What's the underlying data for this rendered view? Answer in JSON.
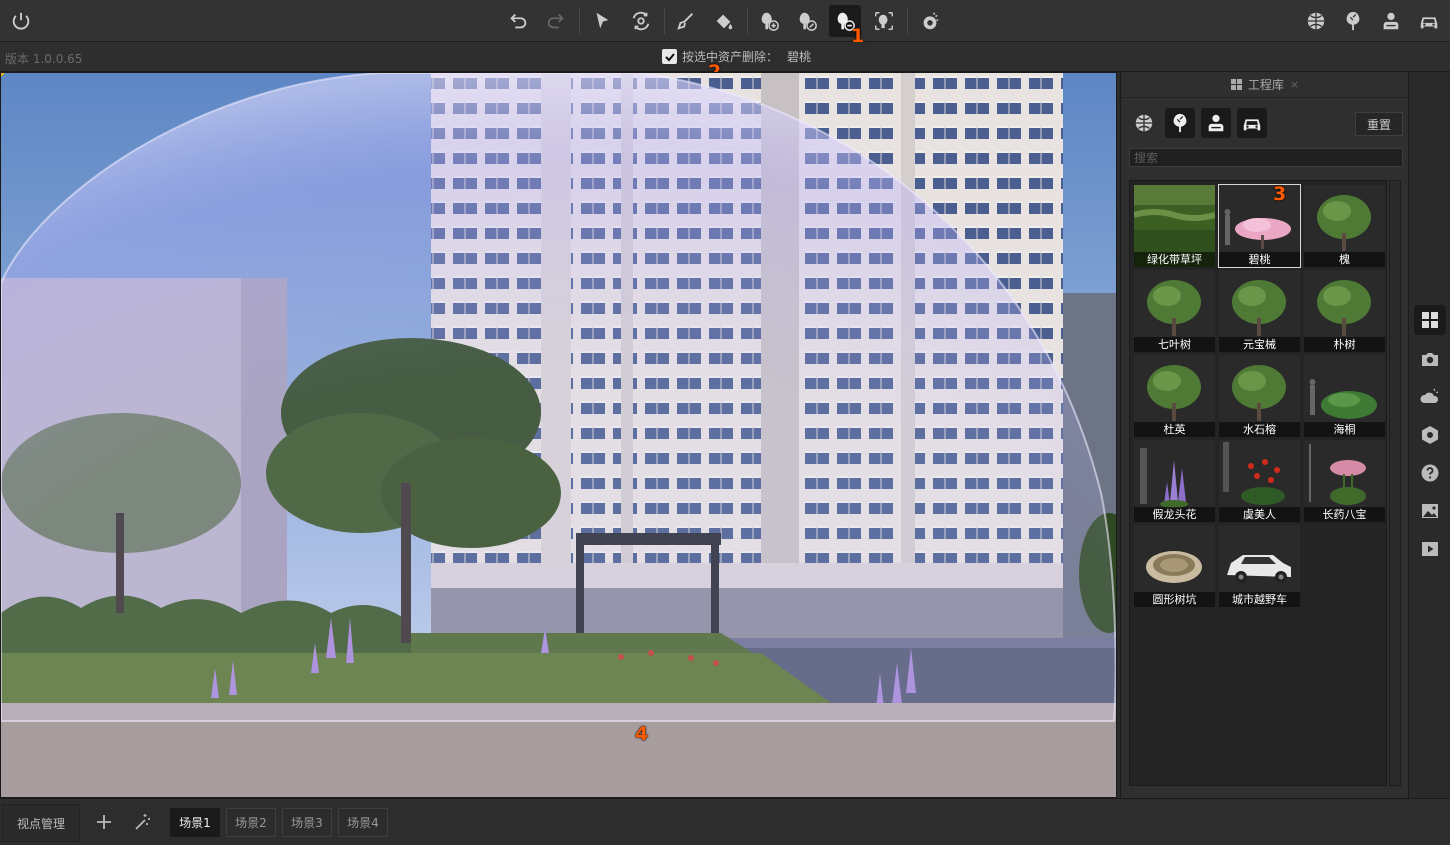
{
  "toolbar": {
    "buttons": [
      "power-icon",
      "undo-icon",
      "redo-icon",
      "select-arrow-icon",
      "orbit-target-icon",
      "brush-icon",
      "fill-bucket-icon",
      "plant-add-icon",
      "plant-paint-icon",
      "plant-remove-icon",
      "plant-scatter-icon",
      "weather-icon",
      "globe-material-icon",
      "tree-category-icon",
      "people-category-icon",
      "car-category-icon"
    ],
    "active": "plant-remove-icon"
  },
  "subbar": {
    "version": "版本 1.0.0.65",
    "option_label": "按选中资产删除：",
    "option_value": "碧桃",
    "option_checked": true
  },
  "markers": [
    "1",
    "2",
    "3",
    "4"
  ],
  "panel": {
    "title": "工程库",
    "close": "×",
    "reset_label": "重置",
    "search_placeholder": "搜索",
    "categories": [
      "material-globe-icon",
      "tree-icon",
      "people-icon",
      "car-icon"
    ],
    "assets": [
      {
        "label": "绿化带草坪",
        "kind": "grass"
      },
      {
        "label": "碧桃",
        "kind": "peach",
        "selected": true
      },
      {
        "label": "槐",
        "kind": "tree"
      },
      {
        "label": "七叶树",
        "kind": "tree"
      },
      {
        "label": "元宝械",
        "kind": "tree"
      },
      {
        "label": "朴树",
        "kind": "tree"
      },
      {
        "label": "杜英",
        "kind": "tree"
      },
      {
        "label": "水石榕",
        "kind": "tree"
      },
      {
        "label": "海桐",
        "kind": "shrub"
      },
      {
        "label": "假龙头花",
        "kind": "flower-purple"
      },
      {
        "label": "虞美人",
        "kind": "flower-red"
      },
      {
        "label": "长药八宝",
        "kind": "flower-pink"
      },
      {
        "label": "圆形树坑",
        "kind": "pit"
      },
      {
        "label": "城市越野车",
        "kind": "car"
      }
    ]
  },
  "sidebar": [
    "library-grid-icon",
    "camera-icon",
    "weather-cloud-icon",
    "settings-hex-icon",
    "help-icon",
    "image-icon",
    "play-icon"
  ],
  "bottom": {
    "viewpoint_label": "视点管理",
    "scenes": [
      "场景1",
      "场景2",
      "场景3",
      "场景4"
    ],
    "active_scene": "场景1"
  },
  "colors": {
    "accent_marker": "#ff5a00",
    "bg": "#2b2b2b"
  }
}
